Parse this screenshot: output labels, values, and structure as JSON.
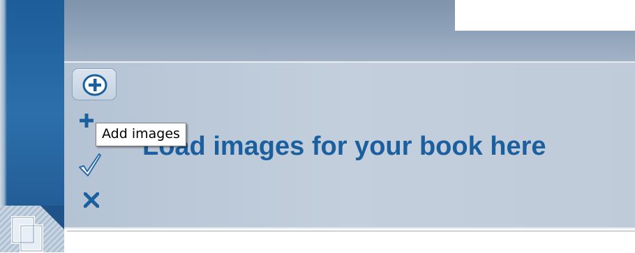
{
  "toolbar": {
    "buttons": [
      {
        "icon": "add-circle-icon",
        "tooltip": "Add images"
      },
      {
        "icon": "plus-icon"
      },
      {
        "icon": "checkmark-icon"
      },
      {
        "icon": "remove-x-icon"
      }
    ]
  },
  "main": {
    "heading": "Load images for your book here"
  },
  "tooltip": {
    "text": "Add images"
  },
  "sidebar": {
    "icon": "pages-stack-icon"
  },
  "colors": {
    "accent": "#1c5f9e",
    "sidebar": "#245f99",
    "panel": "#c0ccda",
    "header_band": "#8fa3ba"
  }
}
